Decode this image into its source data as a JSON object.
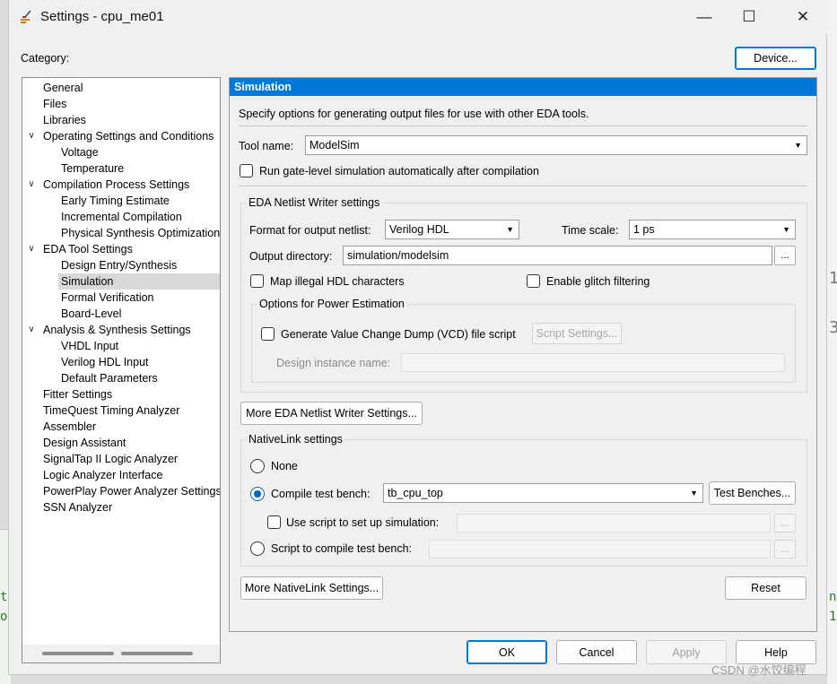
{
  "window": {
    "title": "Settings - cpu_me01"
  },
  "window_controls": {
    "minimize": "—",
    "maximize": "☐",
    "close": "✕"
  },
  "category_label": "Category:",
  "device_button": "Device...",
  "tree": {
    "items": [
      {
        "label": "General",
        "level": 0
      },
      {
        "label": "Files",
        "level": 0
      },
      {
        "label": "Libraries",
        "level": 0
      },
      {
        "label": "Operating Settings and Conditions",
        "level": 0,
        "expanded": true
      },
      {
        "label": "Voltage",
        "level": 1
      },
      {
        "label": "Temperature",
        "level": 1
      },
      {
        "label": "Compilation Process Settings",
        "level": 0,
        "expanded": true
      },
      {
        "label": "Early Timing Estimate",
        "level": 1
      },
      {
        "label": "Incremental Compilation",
        "level": 1
      },
      {
        "label": "Physical Synthesis Optimization",
        "level": 1
      },
      {
        "label": "EDA Tool Settings",
        "level": 0,
        "expanded": true
      },
      {
        "label": "Design Entry/Synthesis",
        "level": 1
      },
      {
        "label": "Simulation",
        "level": 1,
        "selected": true
      },
      {
        "label": "Formal Verification",
        "level": 1
      },
      {
        "label": "Board-Level",
        "level": 1
      },
      {
        "label": "Analysis & Synthesis Settings",
        "level": 0,
        "expanded": true
      },
      {
        "label": "VHDL Input",
        "level": 1
      },
      {
        "label": "Verilog HDL Input",
        "level": 1
      },
      {
        "label": "Default Parameters",
        "level": 1
      },
      {
        "label": "Fitter Settings",
        "level": 0
      },
      {
        "label": "TimeQuest Timing Analyzer",
        "level": 0
      },
      {
        "label": "Assembler",
        "level": 0
      },
      {
        "label": "Design Assistant",
        "level": 0
      },
      {
        "label": "SignalTap II Logic Analyzer",
        "level": 0
      },
      {
        "label": "Logic Analyzer Interface",
        "level": 0
      },
      {
        "label": "PowerPlay Power Analyzer Settings",
        "level": 0
      },
      {
        "label": "SSN Analyzer",
        "level": 0
      }
    ]
  },
  "simulation": {
    "header": "Simulation",
    "description": "Specify options for generating output files for use with other EDA tools.",
    "tool_name_label": "Tool name:",
    "tool_name_value": "ModelSim",
    "run_gate_level_label": "Run gate-level simulation automatically after compilation",
    "netlist_group": {
      "title": "EDA Netlist Writer settings",
      "format_label": "Format for output netlist:",
      "format_value": "Verilog HDL",
      "time_scale_label": "Time scale:",
      "time_scale_value": "1 ps",
      "output_dir_label": "Output directory:",
      "output_dir_value": "simulation/modelsim",
      "browse_label": "...",
      "map_illegal_label": "Map illegal HDL characters",
      "glitch_label": "Enable glitch filtering",
      "power_group": {
        "title": "Options for Power Estimation",
        "vcd_label": "Generate Value Change Dump (VCD) file script",
        "script_settings_label": "Script Settings...",
        "design_instance_label": "Design instance name:"
      }
    },
    "more_netlist_button": "More EDA Netlist Writer Settings...",
    "nativelink_group": {
      "title": "NativeLink settings",
      "none_label": "None",
      "compile_tb_label": "Compile test bench:",
      "compile_tb_value": "tb_cpu_top",
      "test_benches_button": "Test Benches...",
      "use_script_label": "Use script to set up simulation:",
      "script_compile_label": "Script to compile test bench:",
      "browse_label": "..."
    },
    "more_nativelink_button": "More NativeLink Settings...",
    "reset_button": "Reset"
  },
  "footer": {
    "ok": "OK",
    "cancel": "Cancel",
    "apply": "Apply",
    "help": "Help"
  },
  "watermark": "CSDN @水饺编程",
  "background": {
    "left_glyph_1": "t",
    "left_glyph_2": "o",
    "right_glyph_1": "n",
    "right_glyph_2": "1",
    "right_num_1": "1",
    "right_num_2": "3"
  },
  "colors": {
    "accent": "#0078d7",
    "selection": "#d9d9d9",
    "radio_blue": "#0067c0"
  }
}
